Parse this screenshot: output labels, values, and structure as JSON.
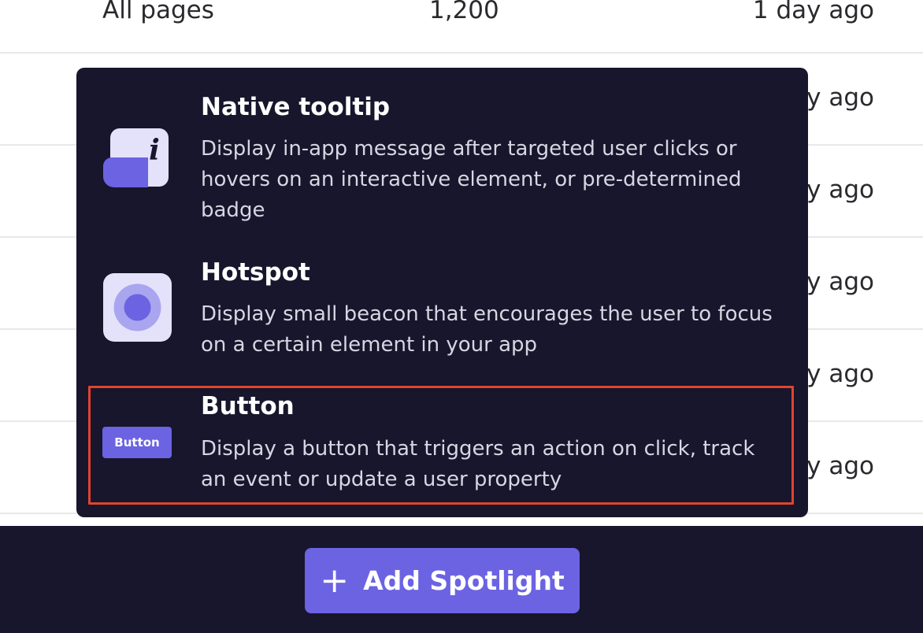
{
  "table": {
    "rows": [
      {
        "page": "All pages",
        "count": "1,200",
        "updated": "1 day ago"
      },
      {
        "page": "",
        "count": "",
        "updated": "y ago"
      },
      {
        "page": "",
        "count": "",
        "updated": "y ago"
      },
      {
        "page": "",
        "count": "",
        "updated": "y ago"
      },
      {
        "page": "",
        "count": "",
        "updated": "y ago"
      },
      {
        "page": "",
        "count": "",
        "updated": "y ago"
      }
    ]
  },
  "menu": {
    "options": [
      {
        "title": "Native tooltip",
        "description": "Display in-app message after targeted user clicks or hovers on an interactive element, or pre-determined badge",
        "icon": "tooltip-info-icon"
      },
      {
        "title": "Hotspot",
        "description": "Display small beacon that encourages the user to focus on a certain element in your app",
        "icon": "hotspot-beacon-icon"
      },
      {
        "title": "Button",
        "description": "Display a button that triggers an action on click, track an event or update a user property",
        "icon": "button-preview-icon",
        "icon_label": "Button",
        "highlighted": true
      }
    ]
  },
  "footer": {
    "add_button_label": "Add Spotlight",
    "add_button_icon": "plus-icon"
  },
  "colors": {
    "dark_surface": "#17162c",
    "accent": "#6b63e2",
    "highlight_border": "#e0442e"
  }
}
